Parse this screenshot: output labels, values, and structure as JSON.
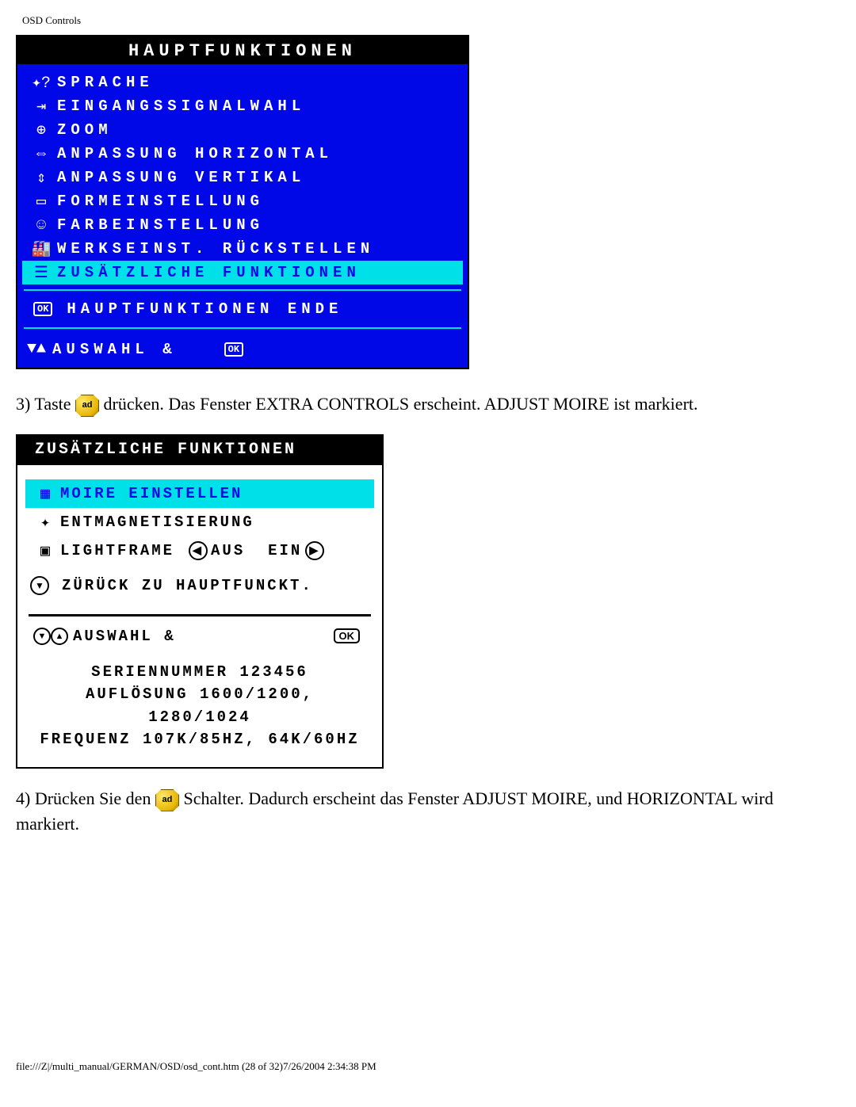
{
  "header": "OSD Controls",
  "osd1": {
    "title": "HAUPTFUNKTIONEN",
    "items": [
      "SPRACHE",
      "EINGANGSSIGNALWAHL",
      "ZOOM",
      "ANPASSUNG HORIZONTAL",
      "ANPASSUNG VERTIKAL",
      "FORMEINSTELLUNG",
      "FARBEINSTELLUNG",
      "WERKSEINST. RÜCKSTELLEN",
      "ZUSÄTZLICHE FUNKTIONEN"
    ],
    "end": "HAUPTFUNKTIONEN ENDE",
    "footer": "AUSWAHL &",
    "ok": "OK"
  },
  "step3": {
    "pre": "3) Taste ",
    "post": " drücken. Das Fenster EXTRA CONTROLS erscheint. ADJUST MOIRE ist markiert.",
    "ok": "ad"
  },
  "osd2": {
    "title": "ZUSÄTZLICHE FUNKTIONEN",
    "moire": "MOIRE EINSTELLEN",
    "degauss": "ENTMAGNETISIERUNG",
    "lightframe": "LIGHTFRAME",
    "aus": "AUS",
    "ein": "EIN",
    "back": "ZÜRÜCK ZU HAUPTFUNCKT.",
    "select": "AUSWAHL &",
    "serial_label": "SERIENNUMMER",
    "serial": "123456",
    "res_label": "AUFLÖSUNG",
    "res": "1600/1200, 1280/1024",
    "freq_label": "FREQUENZ",
    "freq": "107K/85HZ, 64K/60HZ",
    "ok": "OK"
  },
  "step4": {
    "pre": "4) Drücken Sie den  ",
    "post": "  Schalter. Dadurch erscheint das Fenster ADJUST MOIRE, und HORIZONTAL wird markiert.",
    "ok": "ad"
  },
  "footer": "file:///Z|/multi_manual/GERMAN/OSD/osd_cont.htm (28 of 32)7/26/2004 2:34:38 PM"
}
